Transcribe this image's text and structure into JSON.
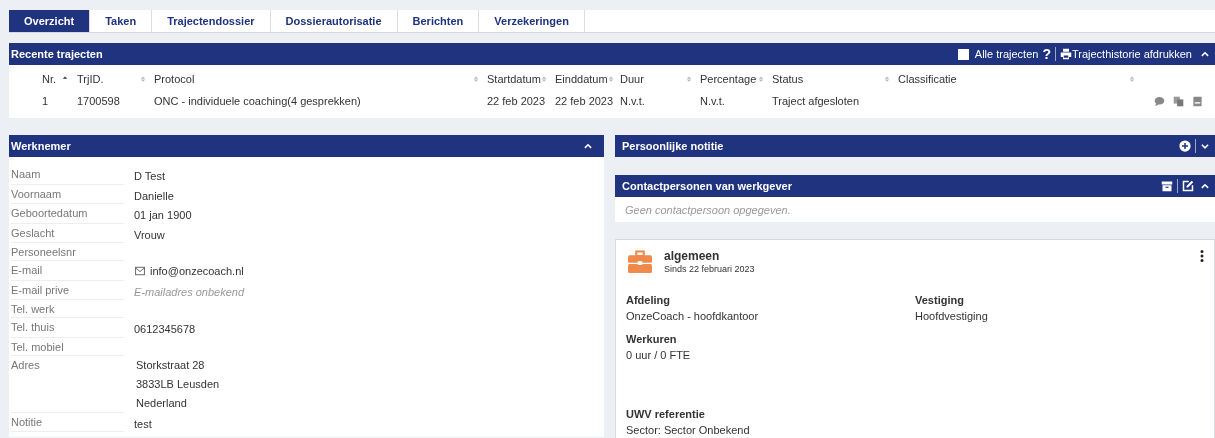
{
  "tabs": [
    {
      "label": "Overzicht",
      "selected": true
    },
    {
      "label": "Taken",
      "selected": false
    },
    {
      "label": "Trajectendossier",
      "selected": false
    },
    {
      "label": "Dossierautorisatie",
      "selected": false
    },
    {
      "label": "Berichten",
      "selected": false
    },
    {
      "label": "Verzekeringen",
      "selected": false
    }
  ],
  "recent": {
    "title": "Recente trajecten",
    "all_toggle": {
      "label": "Alle trajecten",
      "checked": false
    },
    "help_label": "?",
    "print_label": "Trajecthistorie afdrukken",
    "expanded": true,
    "columns": [
      {
        "label": "Nr.",
        "sorted": true
      },
      {
        "label": "TrjID.",
        "sorted": false
      },
      {
        "label": "Protocol",
        "sorted": false
      },
      {
        "label": "Startdatum",
        "sorted": false
      },
      {
        "label": "Einddatum",
        "sorted": false
      },
      {
        "label": "Duur",
        "sorted": false
      },
      {
        "label": "Percentage",
        "sorted": false
      },
      {
        "label": "Status",
        "sorted": false
      },
      {
        "label": "Classificatie",
        "sorted": false
      }
    ],
    "rows": [
      {
        "cells": [
          "1",
          "1700598",
          "ONC - individuele coaching(4 gesprekken)",
          "22 feb 2023",
          "22 feb 2023",
          "N.v.t.",
          "N.v.t.",
          "Traject afgesloten",
          ""
        ]
      }
    ]
  },
  "employee": {
    "title": "Werknemer",
    "expanded": true,
    "fields": [
      {
        "label": "Naam",
        "kind": "text",
        "values": [
          "D Test"
        ]
      },
      {
        "label": "Voornaam",
        "kind": "text",
        "values": [
          "Danielle"
        ]
      },
      {
        "label": "Geboortedatum",
        "kind": "text",
        "values": [
          "01 jan 1900"
        ]
      },
      {
        "label": "Geslacht",
        "kind": "text",
        "values": [
          "Vrouw"
        ]
      },
      {
        "label": "Personeelsnr",
        "kind": "text"
      },
      {
        "label": "E-mail",
        "kind": "email",
        "values": [
          "info@onzecoach.nl"
        ]
      },
      {
        "label": "E-mail prive",
        "kind": "muted",
        "values": [
          "E-mailadres onbekend"
        ]
      },
      {
        "label": "Tel. werk",
        "kind": "text"
      },
      {
        "label": "Tel. thuis",
        "kind": "text",
        "values": [
          "0612345678"
        ]
      },
      {
        "label": "Tel. mobiel",
        "kind": "text"
      },
      {
        "label": "Adres",
        "kind": "address",
        "values": [
          "Storkstraat 28",
          "3833LB Leusden",
          "Nederland"
        ]
      },
      {
        "label": "Notitie",
        "kind": "text",
        "values": [
          "test"
        ]
      }
    ]
  },
  "note": {
    "title": "Persoonlijke notitie",
    "expanded": false
  },
  "contacts": {
    "title": "Contactpersonen van werkgever",
    "expanded": true,
    "empty_text": "Geen contactpersoon opgegeven."
  },
  "employment": {
    "title": "algemeen",
    "since": "Sinds 22 februari 2023",
    "fields": [
      {
        "label": "Afdeling",
        "value": "OnzeCoach - hoofdkantoor"
      },
      {
        "label": "Vestiging",
        "value": "Hoofdvestiging"
      },
      {
        "label": "Werkuren",
        "value": "0 uur / 0 FTE"
      }
    ],
    "reference": {
      "label": "UWV referentie",
      "value": "Sector: Sector Onbekend"
    }
  }
}
